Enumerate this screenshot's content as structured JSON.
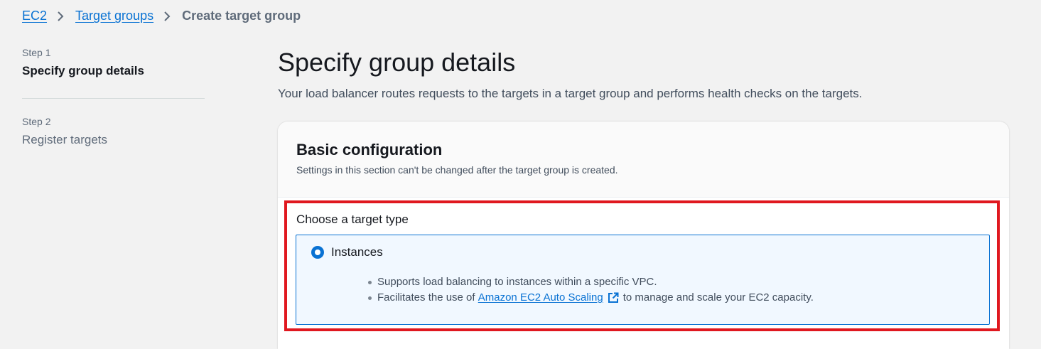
{
  "breadcrumb": {
    "items": [
      {
        "label": "EC2"
      },
      {
        "label": "Target groups"
      }
    ],
    "current": "Create target group"
  },
  "steps": [
    {
      "step": "Step 1",
      "title": "Specify group details",
      "active": true
    },
    {
      "step": "Step 2",
      "title": "Register targets",
      "active": false
    }
  ],
  "main": {
    "title": "Specify group details",
    "description": "Your load balancer routes requests to the targets in a target group and performs health checks on the targets."
  },
  "basic_config": {
    "title": "Basic configuration",
    "description": "Settings in this section can't be changed after the target group is created.",
    "target_type_label": "Choose a target type",
    "option": {
      "label": "Instances",
      "selected": true,
      "bullet1": "Supports load balancing to instances within a specific VPC.",
      "bullet2_prefix": "Facilitates the use of",
      "bullet2_link": "Amazon EC2 Auto Scaling",
      "bullet2_suffix": "to manage and scale your EC2 capacity."
    }
  },
  "colors": {
    "link": "#0972d3",
    "highlight": "#e0181f",
    "selected_bg": "#f1f8ff"
  },
  "icons": [
    "chevron-right-icon",
    "external-link-icon"
  ]
}
